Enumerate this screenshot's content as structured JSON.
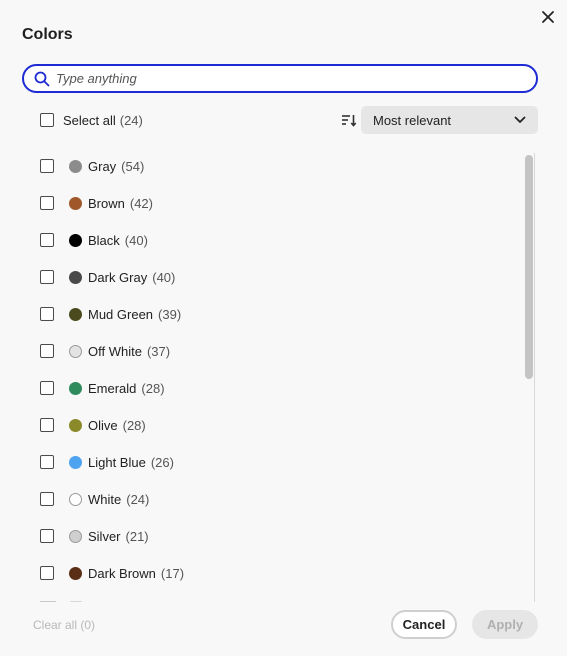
{
  "dialog": {
    "title": "Colors",
    "close_icon": "close-icon"
  },
  "search": {
    "placeholder": "Type anything",
    "value": "",
    "icon": "search-icon"
  },
  "select_all": {
    "label": "Select all",
    "count": "(24)",
    "checked": false
  },
  "sort": {
    "icon": "sort-icon",
    "selected": "Most relevant",
    "icon_chevron": "chevron-down-icon"
  },
  "colors": [
    {
      "name": "Gray",
      "count": "(54)",
      "swatch": "#8c8c8c",
      "checked": false
    },
    {
      "name": "Brown",
      "count": "(42)",
      "swatch": "#a0582a",
      "checked": false
    },
    {
      "name": "Black",
      "count": "(40)",
      "swatch": "#000000",
      "checked": false
    },
    {
      "name": "Dark Gray",
      "count": "(40)",
      "swatch": "#4a4a4a",
      "checked": false
    },
    {
      "name": "Mud Green",
      "count": "(39)",
      "swatch": "#4a4a1e",
      "checked": false
    },
    {
      "name": "Off White",
      "count": "(37)",
      "swatch": "#e3e3e3",
      "checked": false
    },
    {
      "name": "Emerald",
      "count": "(28)",
      "swatch": "#2f8a5c",
      "checked": false
    },
    {
      "name": "Olive",
      "count": "(28)",
      "swatch": "#8a8a2a",
      "checked": false
    },
    {
      "name": "Light Blue",
      "count": "(26)",
      "swatch": "#4da3f0",
      "checked": false
    },
    {
      "name": "White",
      "count": "(24)",
      "swatch": "#ffffff",
      "checked": false
    },
    {
      "name": "Silver",
      "count": "(21)",
      "swatch": "#cfcfcf",
      "checked": false
    },
    {
      "name": "Dark Brown",
      "count": "(17)",
      "swatch": "#5a2e14",
      "checked": false
    }
  ],
  "footer": {
    "clear_all": "Clear all (0)",
    "cancel_label": "Cancel",
    "apply_label": "Apply"
  },
  "theme": {
    "focus_color": "#1d2bd4",
    "background": "#f8f8f8"
  }
}
